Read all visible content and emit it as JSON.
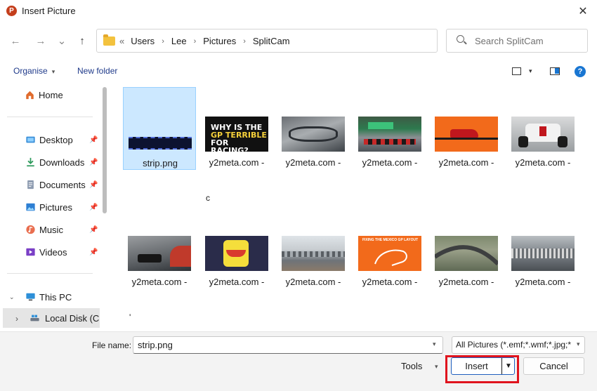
{
  "window": {
    "title": "Insert Picture",
    "app_icon_letter": "P",
    "close_glyph": "✕"
  },
  "nav": {
    "back_glyph": "←",
    "forward_glyph": "→",
    "recent_glyph": "⌄",
    "up_glyph": "↑"
  },
  "address": {
    "overflow_glyph": "«",
    "separator_glyph": "›",
    "crumbs": [
      "Users",
      "Lee",
      "Pictures",
      "SplitCam"
    ],
    "dropdown_glyph": "⌄",
    "refresh_glyph": "↻"
  },
  "search": {
    "placeholder": "Search SplitCam"
  },
  "toolbar": {
    "organise_label": "Organise",
    "caret_glyph": "▾",
    "new_folder_label": "New folder",
    "help_glyph": "?"
  },
  "sidebar": {
    "pin_glyph": "📌",
    "items": [
      {
        "label": "Home",
        "icon": "home-icon",
        "pinned": false
      },
      {
        "label": "Desktop",
        "icon": "desktop-icon",
        "pinned": true
      },
      {
        "label": "Downloads",
        "icon": "download-icon",
        "pinned": true
      },
      {
        "label": "Documents",
        "icon": "documents-icon",
        "pinned": true
      },
      {
        "label": "Pictures",
        "icon": "pictures-icon",
        "pinned": true
      },
      {
        "label": "Music",
        "icon": "music-icon",
        "pinned": true
      },
      {
        "label": "Videos",
        "icon": "videos-icon",
        "pinned": true
      },
      {
        "label": "This PC",
        "icon": "pc-icon",
        "pinned": false
      },
      {
        "label": "Local Disk (C:",
        "icon": "disk-icon",
        "pinned": false
      }
    ],
    "expand_glyph": "›",
    "expanded_glyph": "⌄"
  },
  "files": {
    "items": [
      {
        "label": "strip.png",
        "selected": true,
        "thumb": "strip"
      },
      {
        "label": "y2meta.com -",
        "thumb": "title-card",
        "thumb_lines": [
          "WHY IS THE",
          "GP TERRIBLE",
          "FOR RACING?"
        ]
      },
      {
        "label": "y2meta.com -",
        "thumb": "track-aerial"
      },
      {
        "label": "y2meta.com -",
        "thumb": "race-start"
      },
      {
        "label": "y2meta.com -",
        "thumb": "orange-car"
      },
      {
        "label": "y2meta.com -",
        "thumb": "white-car"
      },
      {
        "label": "y2meta.com -",
        "thumb": "dark-car"
      },
      {
        "label": "y2meta.com -",
        "thumb": "cartoon"
      },
      {
        "label": "y2meta.com -",
        "thumb": "stadium"
      },
      {
        "label": "y2meta.com -",
        "thumb": "track-map",
        "thumb_lines": [
          "FIXING THE MEXICO GP LAYOUT"
        ]
      },
      {
        "label": "y2meta.com -",
        "thumb": "aerial-curve"
      },
      {
        "label": "y2meta.com -",
        "thumb": "grandstand"
      }
    ],
    "extra_row1": "c",
    "extra_row2": "'"
  },
  "bottom": {
    "file_name_label": "File name:",
    "file_name_value": "strip.png",
    "file_type_value": "All Pictures (*.emf;*.wmf;*.jpg;*",
    "tools_label": "Tools",
    "insert_label": "Insert",
    "insert_caret": "▼",
    "cancel_label": "Cancel",
    "caret_glyph": "▾"
  },
  "colors": {
    "accent": "#1976d2",
    "selection": "#cce8ff",
    "highlight": "#e0141e",
    "app_icon": "#c43e1c"
  }
}
